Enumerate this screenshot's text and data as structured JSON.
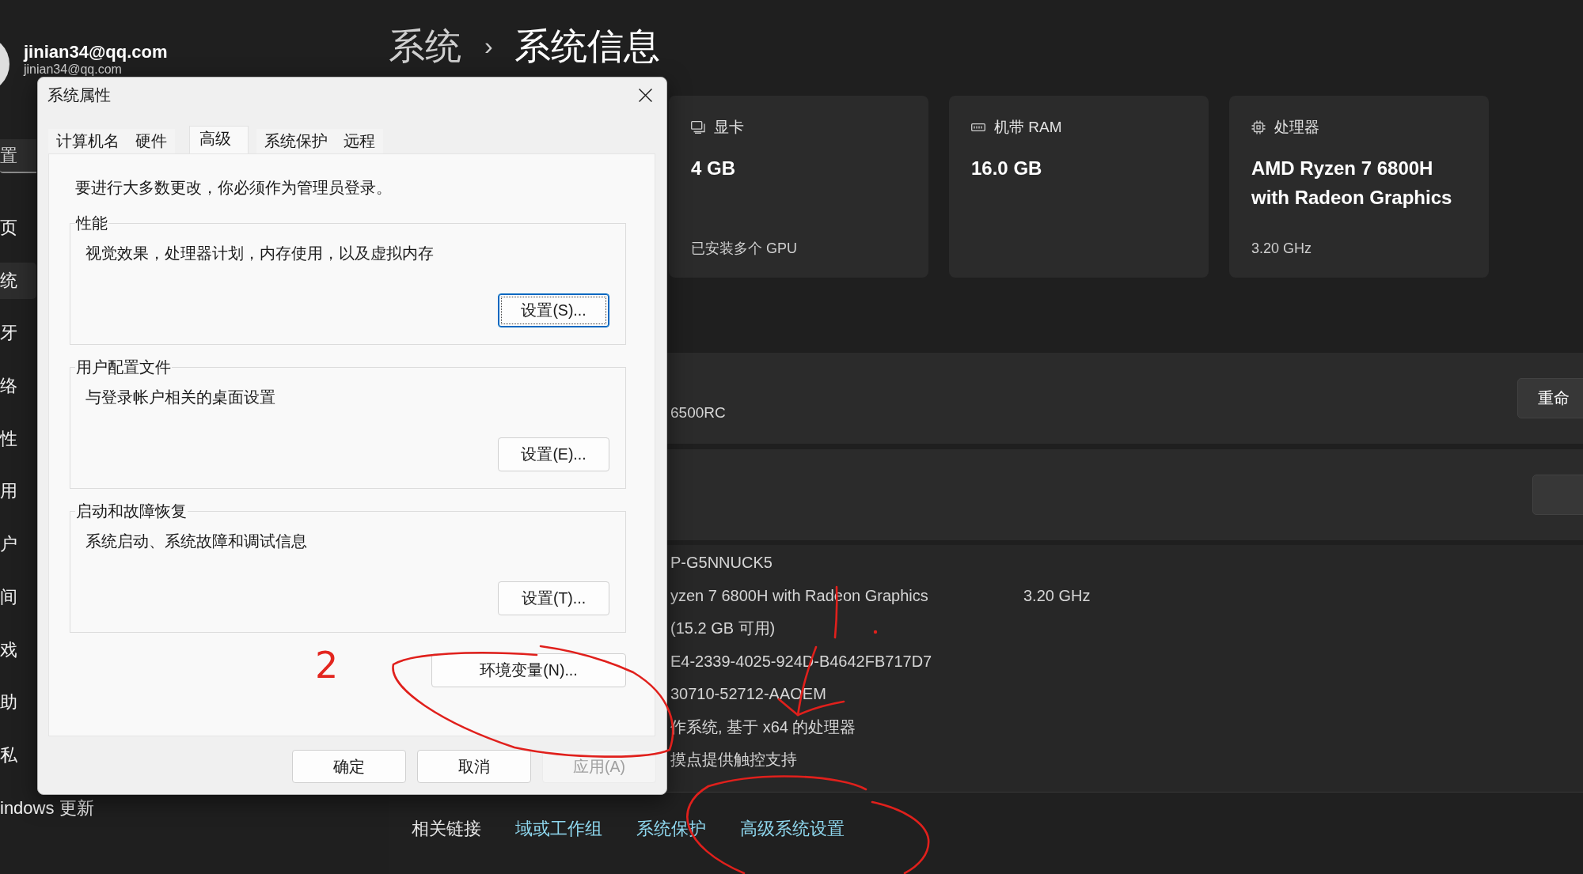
{
  "account": {
    "name": "jinian34@qq.com",
    "email": "jinian34@qq.com"
  },
  "sidebar": {
    "search": {
      "placeholder": "置"
    },
    "items": [
      {
        "label": "页",
        "selected": false
      },
      {
        "label": "统",
        "selected": true
      },
      {
        "label": "牙",
        "selected": false
      },
      {
        "label": "络",
        "selected": false
      },
      {
        "label": "性",
        "selected": false
      },
      {
        "label": "用",
        "selected": false
      },
      {
        "label": "户",
        "selected": false
      },
      {
        "label": "间",
        "selected": false
      },
      {
        "label": "戏",
        "selected": false
      },
      {
        "label": "助",
        "selected": false
      },
      {
        "label": "私",
        "selected": false
      },
      {
        "label": "indows 更新",
        "selected": false
      }
    ]
  },
  "header": {
    "parent": "系统",
    "separator": "›",
    "title": "系统信息"
  },
  "spec_cards": [
    {
      "label": "显卡",
      "value": "4 GB",
      "detail": "已安装多个 GPU"
    },
    {
      "label": "机带 RAM",
      "value": "16.0 GB"
    },
    {
      "label": "处理器",
      "value": "AMD Ryzen 7 6800H with Radeon Graphics",
      "detail": "3.20 GHz"
    }
  ],
  "device_name_row": {
    "value": "6500RC",
    "button": "重命"
  },
  "device_specs": {
    "rows": [
      {
        "value": "P-G5NNUCK5"
      },
      {
        "value": "yzen 7 6800H with Radeon Graphics",
        "detail": "3.20 GHz"
      },
      {
        "value": "(15.2 GB 可用)"
      },
      {
        "value": "E4-2339-4025-924D-B4642FB717D7"
      },
      {
        "value": "30710-52712-AAOEM"
      },
      {
        "value": "作系统, 基于 x64 的处理器"
      },
      {
        "value": "摸点提供触控支持"
      }
    ]
  },
  "related_links": {
    "label": "相关链接",
    "links": [
      "域或工作组",
      "系统保护",
      "高级系统设置"
    ]
  },
  "dialog": {
    "title": "系统属性",
    "tabs": [
      {
        "label": "计算机名",
        "selected": false
      },
      {
        "label": "硬件",
        "selected": false
      },
      {
        "label": "高级",
        "selected": true
      },
      {
        "label": "系统保护",
        "selected": false
      },
      {
        "label": "远程",
        "selected": false
      }
    ],
    "notice": "要进行大多数更改，你必须作为管理员登录。",
    "groups": [
      {
        "title": "性能",
        "description": "视觉效果，处理器计划，内存使用，以及虚拟内存",
        "button": {
          "label": "设置(S)...",
          "focused": true
        }
      },
      {
        "title": "用户配置文件",
        "description": "与登录帐户相关的桌面设置",
        "button": {
          "label": "设置(E)...",
          "focused": false
        }
      },
      {
        "title": "启动和故障恢复",
        "description": "系统启动、系统故障和调试信息",
        "button": {
          "label": "设置(T)...",
          "focused": false
        }
      }
    ],
    "env_button": {
      "label": "环境变量(N)..."
    },
    "buttons": [
      {
        "label": "确定",
        "disabled": false
      },
      {
        "label": "取消",
        "disabled": false
      },
      {
        "label": "应用(A)",
        "disabled": true
      }
    ]
  },
  "annotation": {
    "label": "2"
  }
}
